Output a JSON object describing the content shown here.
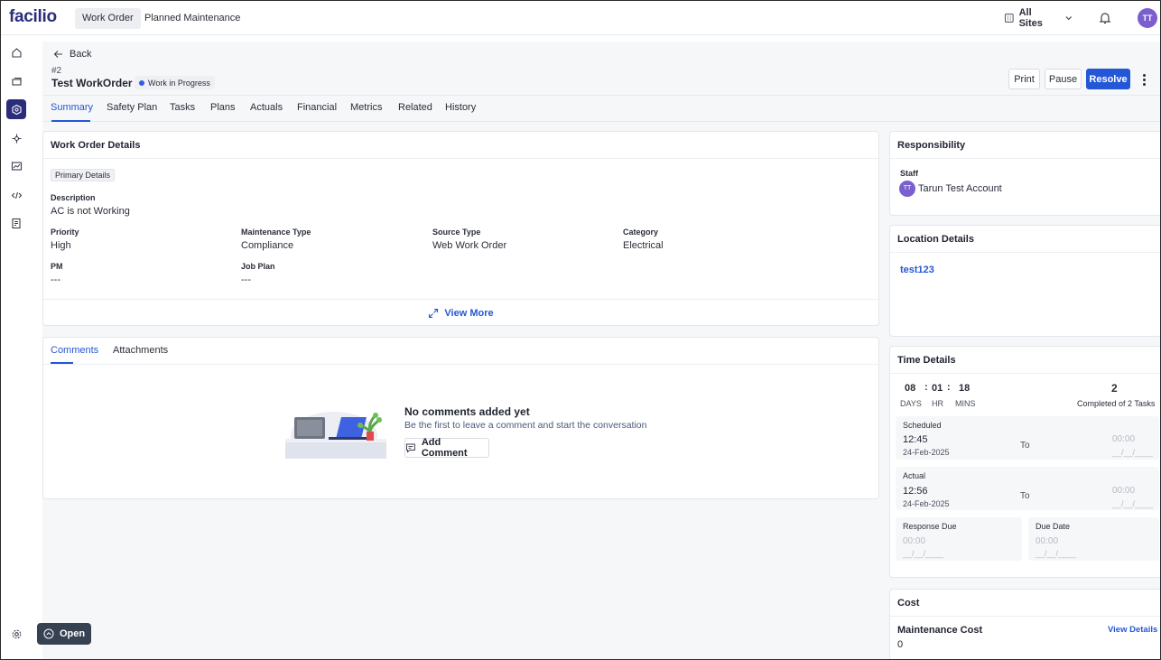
{
  "app": {
    "logo": "facilio"
  },
  "topnav": {
    "tabs": [
      {
        "label": "Work Order",
        "active": true
      },
      {
        "label": "Planned Maintenance",
        "active": false
      }
    ],
    "site_selector": "All Sites",
    "user_initials": "TT"
  },
  "sidebar": {
    "items": [
      {
        "icon": "home-icon"
      },
      {
        "icon": "tickets-icon"
      },
      {
        "icon": "workorder-icon",
        "active": true
      },
      {
        "icon": "hierarchy-icon"
      },
      {
        "icon": "dashboard-icon"
      },
      {
        "icon": "code-icon"
      },
      {
        "icon": "report-icon"
      }
    ],
    "settings_icon": "gear-icon"
  },
  "header": {
    "back_label": "Back",
    "number": "#2",
    "title": "Test WorkOrder",
    "status": "Work in Progress",
    "actions": {
      "print": "Print",
      "pause": "Pause",
      "resolve": "Resolve"
    }
  },
  "tabs": [
    "Summary",
    "Safety Plan",
    "Tasks",
    "Plans",
    "Actuals",
    "Financial",
    "Metrics",
    "Related",
    "History"
  ],
  "details": {
    "title": "Work Order Details",
    "section_chip": "Primary Details",
    "description_label": "Description",
    "description_value": "AC is not Working",
    "fields": [
      {
        "label": "Priority",
        "value": "High"
      },
      {
        "label": "Maintenance Type",
        "value": "Compliance"
      },
      {
        "label": "Source Type",
        "value": "Web Work Order"
      },
      {
        "label": "Category",
        "value": "Electrical"
      },
      {
        "label": "PM",
        "value": "---"
      },
      {
        "label": "Job Plan",
        "value": "---"
      }
    ],
    "view_more": "View More"
  },
  "comments": {
    "tabs": [
      "Comments",
      "Attachments"
    ],
    "empty_title": "No comments added yet",
    "empty_sub": "Be the first to leave a comment and start the conversation",
    "add_button": "Add Comment"
  },
  "responsibility": {
    "title": "Responsibility",
    "staff_label": "Staff",
    "staff_initials": "TT",
    "staff_name": "Tarun Test Account"
  },
  "location": {
    "title": "Location Details",
    "value": "test123"
  },
  "time": {
    "title": "Time Details",
    "days": "08",
    "hr": "01",
    "mins": "18",
    "days_label": "DAYS",
    "hr_label": "HR",
    "mins_label": "MINS",
    "tasks_count": "2",
    "tasks_label": "Completed of 2 Tasks",
    "scheduled": {
      "label": "Scheduled",
      "time": "12:45",
      "date": "24-Feb-2025",
      "to": "To",
      "end_time": "00:00",
      "end_date": "__/__/____"
    },
    "actual": {
      "label": "Actual",
      "time": "12:56",
      "date": "24-Feb-2025",
      "to": "To",
      "end_time": "00:00",
      "end_date": "__/__/____"
    },
    "response_due": {
      "label": "Response Due",
      "time": "00:00",
      "date": "__/__/____"
    },
    "due_date": {
      "label": "Due Date",
      "time": "00:00",
      "date": "__/__/____"
    }
  },
  "cost": {
    "title": "Cost",
    "maintenance_label": "Maintenance Cost",
    "view_details": "View Details",
    "value": "0"
  },
  "footer": {
    "open_label": "Open"
  }
}
